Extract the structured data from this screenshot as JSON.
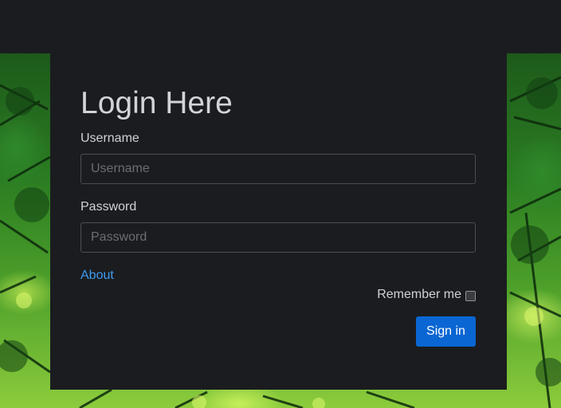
{
  "login": {
    "title": "Login Here",
    "username_label": "Username",
    "username_placeholder": "Username",
    "username_value": "",
    "password_label": "Password",
    "password_placeholder": "Password",
    "password_value": "",
    "about_link": "About",
    "remember_label": "Remember me",
    "remember_checked": false,
    "signin_label": "Sign in"
  },
  "colors": {
    "accent": "#0a66d3",
    "link": "#3d9df2",
    "panel": "#1b1c1f"
  }
}
